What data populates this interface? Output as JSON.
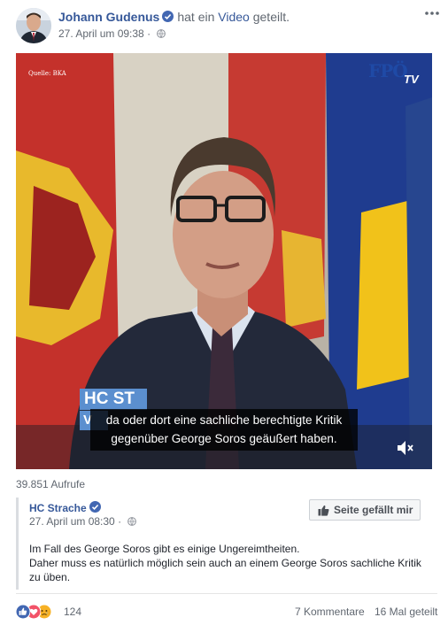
{
  "post": {
    "author": "Johann Gudenus",
    "action_text": "hat ein",
    "video_link": "Video",
    "action_suffix": "geteilt.",
    "timestamp": "27. April um 09:38",
    "audience_icon": "globe-icon",
    "menu_icon": "more-dots-icon"
  },
  "video": {
    "source_label": "Quelle: BKA",
    "logo_text": "FPÖ",
    "logo_tv": "TV",
    "lower_third_line1": "HC ST",
    "lower_third_line2": "V",
    "subtitle_line1": "da oder dort eine sachliche berechtigte Kritik",
    "subtitle_line2": "gegenüber George Soros geäußert haben.",
    "mute_icon": "speaker-muted-icon"
  },
  "views": "39.851 Aufrufe",
  "shared": {
    "page_name": "HC Strache",
    "timestamp": "27. April um 08:30",
    "like_button": "Seite gefällt mir",
    "text_line1": "Im Fall des George Soros gibt es einige Ungereimtheiten.",
    "text_line2": "Daher muss es natürlich möglich sein auch an einem George Soros sachliche Kritik",
    "text_line3": "zu üben."
  },
  "footer": {
    "reaction_icons": [
      "like-icon",
      "love-icon",
      "sad-icon"
    ],
    "reaction_count": "124",
    "comments": "7 Kommentare",
    "shares": "16 Mal geteilt"
  },
  "colors": {
    "link_blue": "#365899",
    "meta_gray": "#606770",
    "like_blue": "#4267b2",
    "love_red": "#f25268",
    "sad_yellow": "#f7b125"
  }
}
